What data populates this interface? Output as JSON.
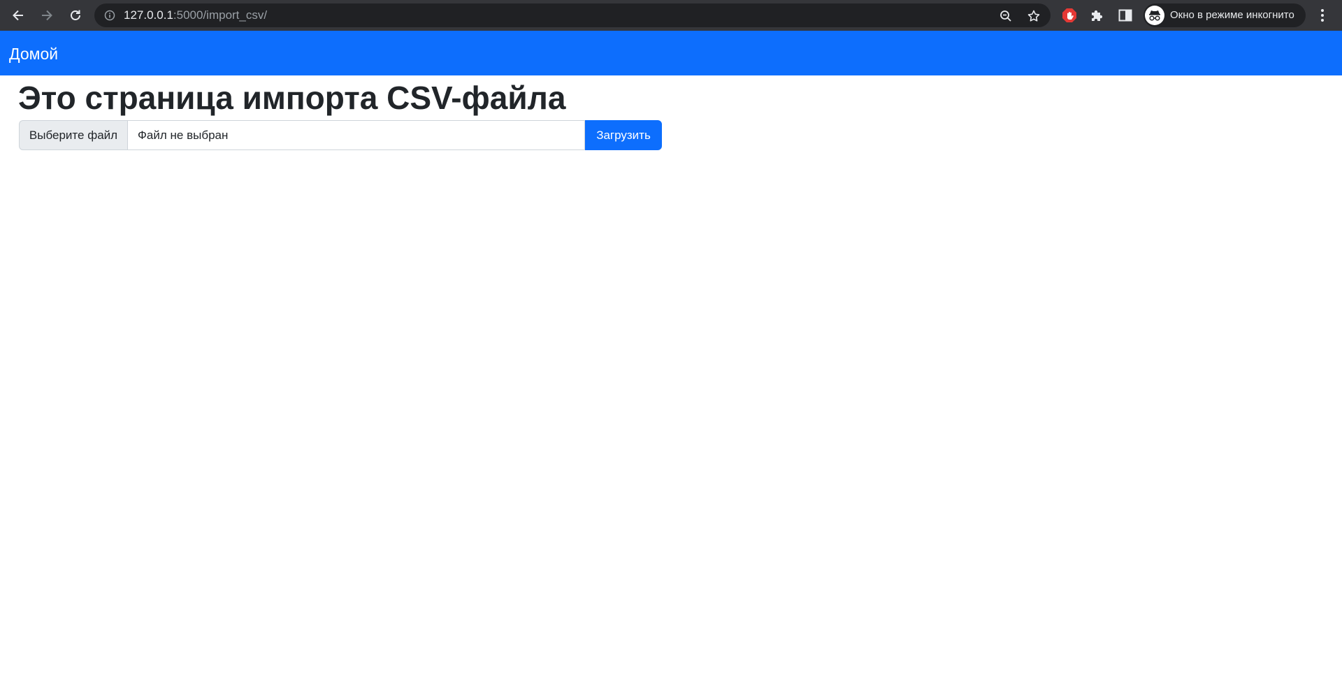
{
  "browser": {
    "url_host": "127.0.0.1",
    "url_path": ":5000/import_csv/",
    "incognito_label": "Окно в режиме инкогнито",
    "icons": [
      "back-arrow-icon",
      "forward-arrow-icon",
      "reload-icon",
      "info-icon",
      "zoom-out-icon",
      "star-icon",
      "adblock-icon",
      "puzzle-icon",
      "side-panel-icon",
      "incognito-icon",
      "more-vert-icon"
    ]
  },
  "navbar": {
    "brand": "Домой",
    "color": "#0d6efd"
  },
  "main": {
    "title": "Это страница импорта CSV-файла",
    "file_button": "Выберите файл",
    "file_status": "Файл не выбран",
    "submit_button": "Загрузить"
  }
}
